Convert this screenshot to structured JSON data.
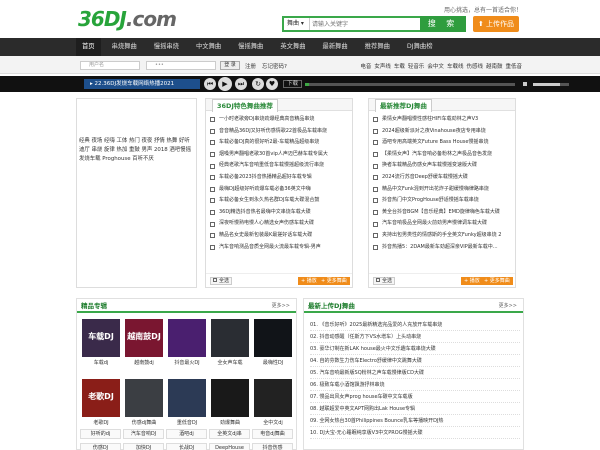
{
  "header": {
    "logo_text": "36DJ",
    "logo_suffix": ".com",
    "tagline": "用心挑选，总有一首适合你！",
    "search_select": "舞曲",
    "search_placeholder": "请输入关键字",
    "search_button": "搜 索",
    "upload_button": "上传作品"
  },
  "nav": {
    "items": [
      "首页",
      "串烧舞曲",
      "慢摇串烧",
      "中文舞曲",
      "慢摇舞曲",
      "英文舞曲",
      "最新舞曲",
      "推荐舞曲",
      "DJ舞曲榜"
    ]
  },
  "login": {
    "user_placeholder": "用户名",
    "login_button": "登 录",
    "register": "注册",
    "forgot": "忘记密码?"
  },
  "toplinks": [
    "电音",
    "女声线",
    "车载",
    "轻音乐",
    "会中文",
    "车载线",
    "伤感线",
    "越南鼓",
    "重低音"
  ],
  "player": {
    "title": "22.36DJ发烧车载网络热播2021",
    "download": "下载",
    "progress": 0.02,
    "volume": 0.75
  },
  "adbox": {
    "tags": "经典 夜场 经嗨 工体 热门 夜夜 抒情 热舞 好听 迪厅 串烧 旋律 热加 重鼓 男声 2018 酒吧慢摇 发烧车载 Proghouse 百听不厌"
  },
  "panel_featured": {
    "title": "36DJ特色舞曲推荐",
    "songs": [
      "一小时老歌旁DJ串烧劲爆经典高音精品串烧",
      "音音精品36DJ又好听伤感情歌22首极品车载串烧",
      "车载必备DJ真的很好听2最-车载精品超级串烧",
      "烟嗓男声翻唱老歌30首vip人声迈巴赫车载专属大",
      "经典老歌汽车音响重低音车载慢摇超级流行串烧",
      "车载必备2023抖音热播精品超好车载专辑",
      "最嗨DJ超级好听劲爆车载必备36英文中嗨",
      "车载必备女生到永久热名群DJ车载大碟混合鼓",
      "36DJ精选抖音热名最嗨中文串烧车载大碟",
      "深夜听慢熟电慢人心精选女声伤感车载大碟",
      "精品名女史最新包装最K最搓好话车载大碟",
      "汽车音响测品音质全网最火流最车载专辑-男声"
    ],
    "select_all": "全选",
    "play_selected": "+ 播放",
    "more": "+ 更多舞曲"
  },
  "panel_latest": {
    "title": "最新推荐DJ舞曲",
    "songs": [
      "柔情女声翻唱慢性感柱HIFI车载劲林之声V3",
      "2024超级新派对之夜Vinahouse夜店专用串烧",
      "酒吧专用高端英文Future Bass House慢摇串烧",
      "【柔情女声】汽车音响必备粉林之声极品音色发烧",
      "换者车载精品伤感女声车载慢摇变速版大碟",
      "2024流行苏音Deep舒缓车载慢摇大碟",
      "精品中文Funk混到开出花炸子甜缓慢嗨律路串烧",
      "抖音热门中文ProgHouse舒适慢摇车载串烧",
      "黄全台抖音BGM【音乐经典】EMD旋律嗨色车载大碟",
      "汽车音响极品全网最火前劲男声慢律调车载大碟",
      "夹持出包男类性的情感斯的手全英文Funky超级串烧 2",
      "抖音热播5：2DAM最新车劲超深亲VIP最新车载中..."
    ],
    "select_all": "全选",
    "play_selected": "+ 播放",
    "more": "+ 更多舞曲"
  },
  "albums": {
    "title": "精品专辑",
    "more": "更多>>",
    "items": [
      {
        "label": "车载dj",
        "cover": "车载DJ",
        "color": "#3a2a4a"
      },
      {
        "label": "越南鼓dj",
        "cover": "越南鼓DJ",
        "color": "#7a1630"
      },
      {
        "label": "抖音最火DJ",
        "cover": "",
        "color": "#4a1f6f"
      },
      {
        "label": "全女声车载",
        "cover": "",
        "color": "#2a2d33"
      },
      {
        "label": "最嗨性DJ",
        "cover": "",
        "color": "#111418"
      },
      {
        "label": "老歌DJ",
        "cover": "老歌DJ",
        "color": "#8a1e18"
      },
      {
        "label": "伤感dj舞曲",
        "cover": "",
        "color": "#3b3e43"
      },
      {
        "label": "重低音DJ",
        "cover": "",
        "color": "#2c3a55"
      },
      {
        "label": "劲爆舞曲",
        "cover": "",
        "color": "#191919"
      },
      {
        "label": "全中文dj",
        "cover": "",
        "color": "#222"
      }
    ],
    "tags": [
      "好听的dj",
      "汽车音响DJ",
      "酒吧dj",
      "全英文dj串",
      "电音dj舞曲",
      "伤感DJ",
      "加快DJ",
      "长战DJ",
      "DeepHouse",
      "抖音伤感"
    ]
  },
  "latest_upload": {
    "title": "最新上传DJ舞曲",
    "more": "更多>>",
    "songs": [
      "01. 《音乐好听》2025最新精选完品爱的人充放开车载串烧",
      "02. 抖音动感醒（任斯方下VS水增车）上头动串烧",
      "03. 豪华订制在新LAK house最火中文乐趣车载串烧大碟",
      "04. 自的芬数生力伤车Electro舒缓律中文跳舞大碟",
      "05. 汽车音响最新版SQ粉林之声车载慢律版CD大碟",
      "06. 极致车载小酒馆飘游抒林串烧",
      "07. 慢品出风女声prog house车碳中文车载版",
      "08. 越联超爱中英文APT网购出Lak House专辑",
      "09. 全网女热台30首Philippines Bounce乳车等播映开DJ热",
      "10. DJ大宝-无心睡眠纯享版V3中文PROG慢摇大碟"
    ]
  }
}
